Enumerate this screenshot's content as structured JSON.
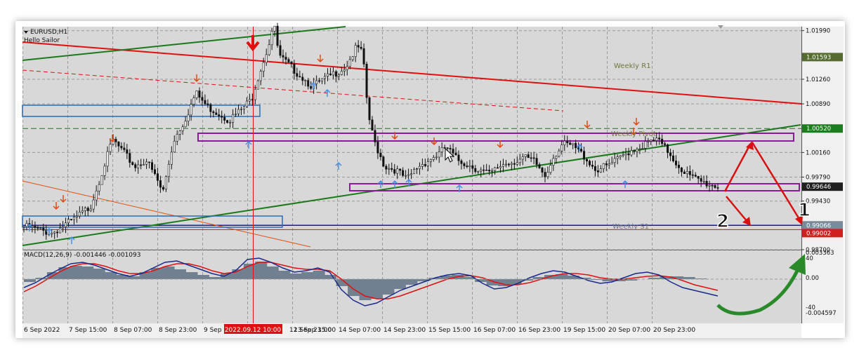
{
  "header": {
    "symbol": "EURUSD,H1",
    "subtitle": "Hello Sailor"
  },
  "levels": {
    "weekly_r1": "Weekly R1",
    "weekly_pivot": "Weekly Pivot",
    "weekly_s1": "Weekly S1"
  },
  "price_axis": {
    "ticks": [
      "1.01990",
      "1.01260",
      "1.00890",
      "1.00160",
      "0.99790",
      "0.99430",
      "0.98700"
    ],
    "markers": [
      {
        "label": "1.01593",
        "color": "#556b2f",
        "value": 1.01593
      },
      {
        "label": "1.00520",
        "color": "#1e7d1e",
        "value": 1.0052
      },
      {
        "label": "0.99646",
        "color": "#202020",
        "value": 0.99646
      },
      {
        "label": "0.99066",
        "color": "#7a8a9a",
        "value": 0.99066
      },
      {
        "label": "0.99002",
        "color": "#d02020",
        "value": 0.99002
      }
    ]
  },
  "macd": {
    "title": "MACD(12,26,9) -0.001446 -0.001093",
    "axis": [
      "0.003363",
      "40",
      "0.00",
      "-40",
      "-0.004597"
    ]
  },
  "time_axis": {
    "labels": [
      "6 Sep 2022",
      "7 Sep 15:00",
      "8 Sep 07:00",
      "8 Sep 23:00",
      "9 Sep 15:00",
      "12 Sep 23:00",
      "13 Sep 15:00",
      "14 Sep 07:00",
      "14 Sep 23:00",
      "15 Sep 15:00",
      "16 Sep 07:00",
      "16 Sep 23:00",
      "19 Sep 15:00",
      "20 Sep 07:00",
      "20 Sep 23:00"
    ],
    "cursor_label": "2022.09.12 10:00"
  },
  "annotations": {
    "one": "1",
    "two": "2"
  },
  "colors": {
    "background": "#d8d8d8",
    "grid": "#9a9a9a",
    "resistance_line": "#e01010",
    "trend_line": "#1a7a1a",
    "box_purple": "#8a1a9a",
    "box_blue": "#2a6ab8",
    "support_line": "#1a1aa0",
    "macd_hist": "#708090",
    "macd_main": "#1a2a8a",
    "macd_signal": "#e01010",
    "arrow_up": "#4a90e0",
    "arrow_down": "#e04a10"
  },
  "chart_data": {
    "type": "candlestick",
    "title": "EURUSD,H1",
    "x_range": [
      "6 Sep 2022",
      "21 Sep 2022"
    ],
    "ylim": [
      0.987,
      1.0205
    ],
    "close_path": [
      [
        0,
        0.9905
      ],
      [
        5,
        0.9895
      ],
      [
        9,
        0.9915
      ],
      [
        12,
        0.9935
      ],
      [
        14,
        0.9985
      ],
      [
        16,
        1.0035
      ],
      [
        18,
        1.0015
      ],
      [
        20,
        0.9995
      ],
      [
        22,
        1.0005
      ],
      [
        24,
        0.9975
      ],
      [
        25,
        0.9955
      ],
      [
        27,
        1.0035
      ],
      [
        29,
        1.0065
      ],
      [
        31,
        1.0105
      ],
      [
        33,
        1.0085
      ],
      [
        35,
        1.0075
      ],
      [
        37,
        1.0065
      ],
      [
        39,
        1.0079
      ],
      [
        41,
        1.0096
      ],
      [
        42,
        1.0125
      ],
      [
        44,
        1.0175
      ],
      [
        45,
        1.021
      ],
      [
        46,
        1.016
      ],
      [
        48,
        1.0145
      ],
      [
        50,
        1.013
      ],
      [
        52,
        1.0115
      ],
      [
        54,
        1.0125
      ],
      [
        56,
        1.0135
      ],
      [
        58,
        1.0145
      ],
      [
        60,
        1.0175
      ],
      [
        61,
        1.0165
      ],
      [
        62,
        1.0075
      ],
      [
        63,
        1.0035
      ],
      [
        65,
        0.9995
      ],
      [
        67,
        0.999
      ],
      [
        69,
        0.9975
      ],
      [
        71,
        0.9995
      ],
      [
        73,
        1.0005
      ],
      [
        75,
        1.0015
      ],
      [
        76,
        1.0025
      ],
      [
        78,
        1.0005
      ],
      [
        80,
        0.9998
      ],
      [
        82,
        0.999
      ],
      [
        84,
        0.9983
      ],
      [
        86,
        0.9998
      ],
      [
        88,
        1.0002
      ],
      [
        90,
        1.0008
      ],
      [
        92,
        1.0002
      ],
      [
        94,
        0.998
      ],
      [
        95,
        1.0005
      ],
      [
        97,
        1.0028
      ],
      [
        99,
        1.0025
      ],
      [
        101,
        1.001
      ],
      [
        103,
        0.999
      ],
      [
        105,
        0.9995
      ],
      [
        107,
        1.0005
      ],
      [
        109,
        1.0018
      ],
      [
        111,
        1.0025
      ],
      [
        113,
        1.0032
      ],
      [
        114,
        1.0035
      ],
      [
        116,
        1.0018
      ],
      [
        118,
        0.9995
      ],
      [
        120,
        0.998
      ],
      [
        122,
        0.9972
      ],
      [
        124,
        0.9967
      ],
      [
        125,
        0.9965
      ]
    ],
    "series": [
      {
        "name": "Weekly R1",
        "type": "level",
        "value": 1.01593
      },
      {
        "name": "Weekly Pivot",
        "type": "level",
        "value": 1.0052
      },
      {
        "name": "Weekly S1",
        "type": "level",
        "value": 0.99066
      }
    ],
    "macd": {
      "histogram": [
        -4,
        2,
        10,
        17,
        19,
        18,
        15,
        10,
        6,
        4,
        10,
        16,
        18,
        14,
        10,
        6,
        3,
        8,
        14,
        22,
        25,
        18,
        12,
        8,
        10,
        12,
        6,
        -10,
        -24,
        -30,
        -28,
        -22,
        -14,
        -8,
        -3,
        2,
        5,
        6,
        3,
        -4,
        -9,
        -10,
        -7,
        -2,
        3,
        6,
        7,
        5,
        2,
        -1,
        -3,
        -3,
        -2,
        0,
        2,
        4,
        4,
        3,
        1,
        0
      ],
      "main": [
        -12,
        -5,
        5,
        14,
        22,
        24,
        20,
        14,
        8,
        4,
        8,
        16,
        24,
        26,
        20,
        14,
        8,
        4,
        12,
        28,
        30,
        24,
        16,
        10,
        12,
        16,
        10,
        -15,
        -30,
        -38,
        -34,
        -25,
        -16,
        -10,
        -4,
        2,
        6,
        8,
        5,
        -6,
        -14,
        -12,
        -6,
        2,
        8,
        12,
        10,
        4,
        -2,
        -6,
        -4,
        2,
        8,
        10,
        6,
        -4,
        -12,
        -16,
        -20,
        -24
      ],
      "signal": [
        -18,
        -10,
        0,
        10,
        18,
        22,
        22,
        18,
        12,
        8,
        8,
        12,
        18,
        22,
        22,
        18,
        12,
        8,
        10,
        18,
        24,
        24,
        20,
        16,
        14,
        14,
        12,
        0,
        -14,
        -24,
        -28,
        -28,
        -24,
        -18,
        -12,
        -6,
        0,
        4,
        5,
        2,
        -4,
        -8,
        -8,
        -5,
        0,
        5,
        8,
        8,
        6,
        2,
        0,
        0,
        2,
        4,
        5,
        3,
        -2,
        -8,
        -12,
        -16
      ]
    }
  }
}
